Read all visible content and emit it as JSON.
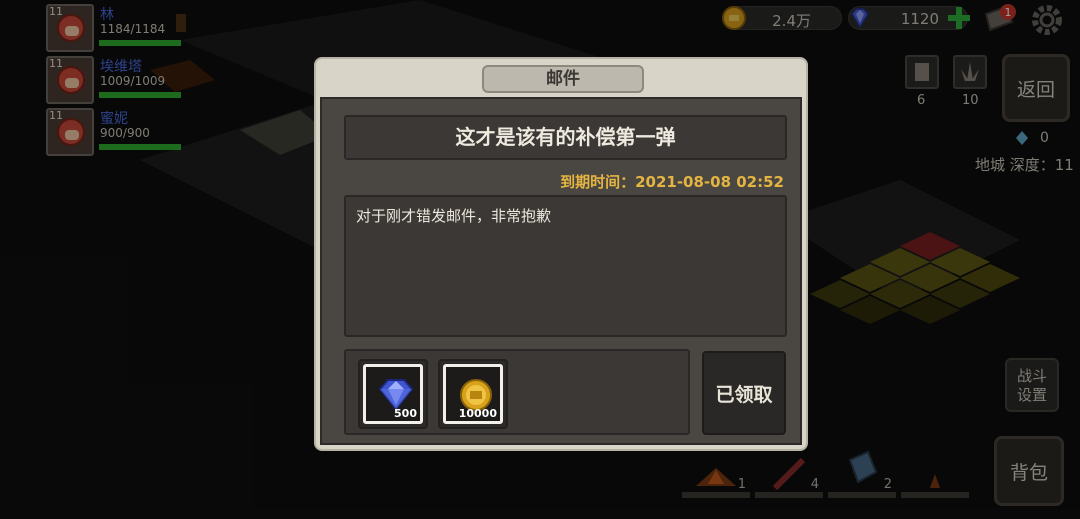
{
  "party": [
    {
      "level": "11",
      "name": "林",
      "hp": "1184/1184",
      "hp_fraction": 1.0
    },
    {
      "level": "11",
      "name": "埃维塔",
      "hp": "1009/1009",
      "hp_fraction": 1.0
    },
    {
      "level": "11",
      "name": "蜜妮",
      "hp": "900/900",
      "hp_fraction": 1.0
    }
  ],
  "currency": {
    "coins": "2.4万",
    "gems": "1120"
  },
  "notification_badge": "1",
  "right_panel": {
    "slot1_count": "6",
    "slot2_count": "10",
    "back_label": "返回",
    "gem_count": "0",
    "dungeon_depth_label": "地城 深度：11",
    "battle_settings_label_line1": "战斗",
    "battle_settings_label_line2": "设置",
    "bag_label": "背包"
  },
  "hotbar": [
    {
      "count": "1"
    },
    {
      "count": "4"
    },
    {
      "count": "2"
    },
    {
      "count": ""
    }
  ],
  "dialog": {
    "title": "邮件",
    "subject": "这才是该有的补偿第一弹",
    "expiry": "到期时间：2021-08-08 02:52",
    "body": "对于刚才错发邮件，非常抱歉",
    "rewards": [
      {
        "icon": "diamond-icon",
        "quantity": "500"
      },
      {
        "icon": "gold-coin-icon",
        "quantity": "10000"
      }
    ],
    "claim_button_label": "已领取"
  },
  "colors": {
    "accent_gold": "#e5b542",
    "hp_green": "#2fae2f",
    "hero_name_blue": "#4a6be0"
  }
}
